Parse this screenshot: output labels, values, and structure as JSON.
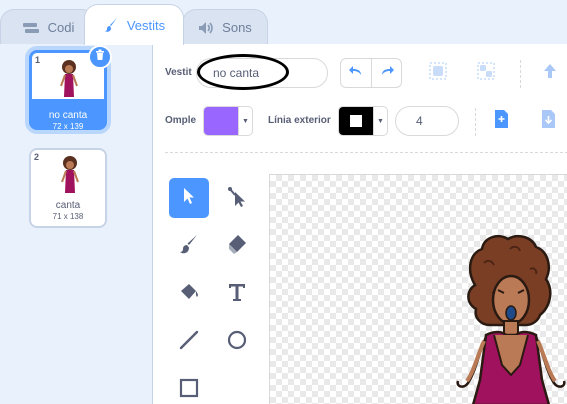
{
  "tabs": [
    {
      "label": "Codi",
      "icon": "code-blocks-icon"
    },
    {
      "label": "Vestits",
      "icon": "paintbrush-icon"
    },
    {
      "label": "Sons",
      "icon": "speaker-icon"
    }
  ],
  "costumes": [
    {
      "number": "1",
      "name": "no canta",
      "size": "72 x 139"
    },
    {
      "number": "2",
      "name": "canta",
      "size": "71 x 138"
    }
  ],
  "editor": {
    "costume_label": "Vestit",
    "costume_name": "no canta",
    "fill_label": "Omple",
    "fill_color": "#9966ff",
    "outline_label": "Línia exterior",
    "outline_color": "#000000",
    "stroke_width": "4"
  },
  "colors": {
    "accent": "#4c97ff",
    "text": "#575e75",
    "background": "#e9f1fc"
  }
}
